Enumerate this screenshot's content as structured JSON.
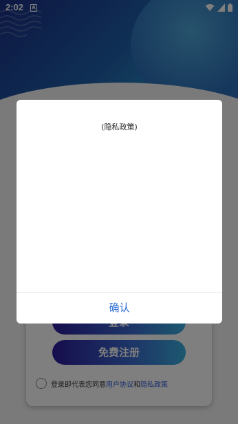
{
  "status_bar": {
    "time": "2:02",
    "notification_glyph": "A",
    "icons": [
      "wifi-icon",
      "signal-icon",
      "battery-icon"
    ]
  },
  "login_card": {
    "login_button": "登录",
    "register_button": "免费注册",
    "agreement": {
      "prefix": "登录即代表您同意",
      "user_agreement_link": "用户协议",
      "and": "和",
      "privacy_link": "隐私政策"
    }
  },
  "dialog": {
    "title": "(隐私政策)",
    "confirm_label": "确认"
  },
  "colors": {
    "accent": "#2a6cd6",
    "link": "#2e5bd8",
    "button_gradient_start": "#2d1b9c",
    "button_gradient_end": "#3bb0e0"
  }
}
